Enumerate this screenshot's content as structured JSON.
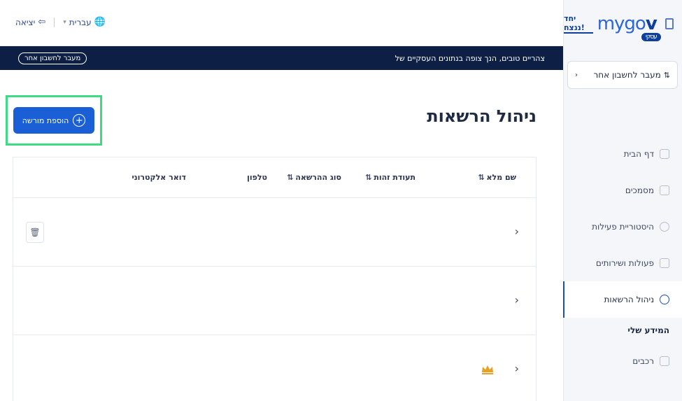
{
  "brand": {
    "name_prefix": "mygo",
    "name_suffix": "v",
    "badge": "עסקי",
    "partner": "יחד ננצח!"
  },
  "header": {
    "exit_label": "יציאה",
    "language_label": "עברית",
    "exit_icon": "logout-icon",
    "language_icon": "globe-icon"
  },
  "banner": {
    "greeting": "צהריים טובים, הנך צופה בנתונים העסקיים של",
    "switch_label": "מעבר לחשבון אחר"
  },
  "sidebar": {
    "switch_account": "מעבר לחשבון אחר",
    "items": [
      {
        "label": "דף הבית",
        "icon": "home-icon"
      },
      {
        "label": "מסמכים",
        "icon": "document-icon"
      },
      {
        "label": "היסטוריית פעילות",
        "icon": "history-icon"
      },
      {
        "label": "פעולות ושירותים",
        "icon": "services-icon"
      },
      {
        "label": "ניהול הרשאות",
        "icon": "users-icon"
      }
    ],
    "section_label": "המידע שלי",
    "extra_item": {
      "label": "רכבים",
      "icon": "car-icon"
    }
  },
  "main": {
    "title": "ניהול הרשאות",
    "add_button": "הוספת מורשה",
    "columns": {
      "full_name": "שם מלא",
      "id_number": "תעודת זהות",
      "permission_type": "סוג ההרשאה",
      "phone": "טלפון",
      "email": "דואר אלקטרוני"
    },
    "rows": [
      {
        "has_trash": true,
        "has_crown": false
      },
      {
        "has_trash": false,
        "has_crown": false
      },
      {
        "has_trash": false,
        "has_crown": true
      }
    ]
  },
  "colors": {
    "primary": "#1a5fd6",
    "banner": "#0d1f45",
    "highlight": "#3ddc84",
    "crown": "#e5a12a"
  }
}
